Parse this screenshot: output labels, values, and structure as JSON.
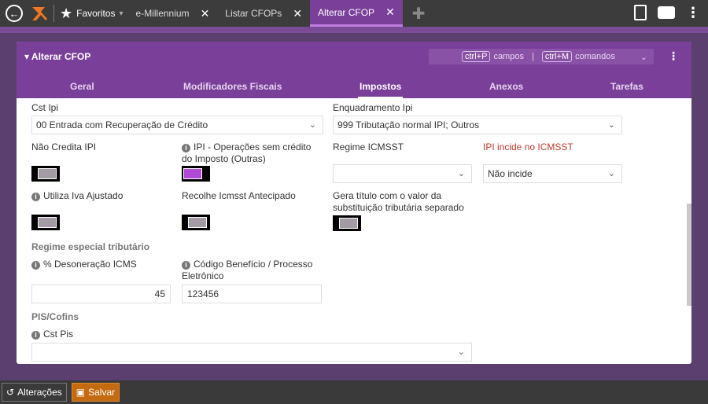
{
  "topbar": {
    "favorites_label": "Favoritos",
    "tabs": [
      {
        "label": "e-Millennium"
      },
      {
        "label": "Listar CFOPs"
      },
      {
        "label": "Alterar CFOP"
      }
    ]
  },
  "panel": {
    "title": "Alterar CFOP",
    "shortcuts": {
      "key1": "ctrl+P",
      "text1": "campos",
      "separator": "|",
      "key2": "ctrl+M",
      "text2": "comandos"
    },
    "tabs": [
      "Geral",
      "Modificadores Fiscais",
      "Impostos",
      "Anexos",
      "Tarefas"
    ],
    "active_tab": "Impostos"
  },
  "form": {
    "cst_ipi": {
      "label": "Cst Ipi",
      "value": "00 Entrada com Recuperação de Crédito"
    },
    "enquadramento_ipi": {
      "label": "Enquadramento Ipi",
      "value": "999 Tributação normal IPI; Outros"
    },
    "nao_credita_ipi": {
      "label": "Não Credita IPI",
      "on": false
    },
    "ipi_operacoes": {
      "label": "IPI - Operações sem crédito do Imposto (Outras)",
      "on": true
    },
    "regime_icmsst": {
      "label": "Regime ICMSST",
      "value": ""
    },
    "ipi_incide_icmsst": {
      "label": "IPI incide no ICMSST",
      "value": "Não incide"
    },
    "utiliza_iva": {
      "label": "Utiliza Iva Ajustado",
      "on": false
    },
    "recolhe_icmsst": {
      "label": "Recolhe Icmsst Antecipado",
      "on": false
    },
    "gera_titulo": {
      "label": "Gera título com o valor da substituição tributária separado",
      "on": false
    },
    "regime_especial": {
      "title": "Regime especial tributário"
    },
    "desoneracao": {
      "label": "% Desoneração ICMS",
      "value": "45"
    },
    "codigo_beneficio": {
      "label": "Código Benefício / Processo Eletrônico",
      "value": "123456"
    },
    "pis_cofins": {
      "title": "PIS/Cofins"
    },
    "cst_pis": {
      "label": "Cst Pis",
      "value": ""
    }
  },
  "bottombar": {
    "alteracoes_label": "Alterações",
    "salvar_label": "Salvar"
  },
  "colors": {
    "accent": "#7a3f99",
    "toggle_on": "#b04ad6",
    "save": "#c46a10",
    "warning_label": "#c0392b"
  }
}
